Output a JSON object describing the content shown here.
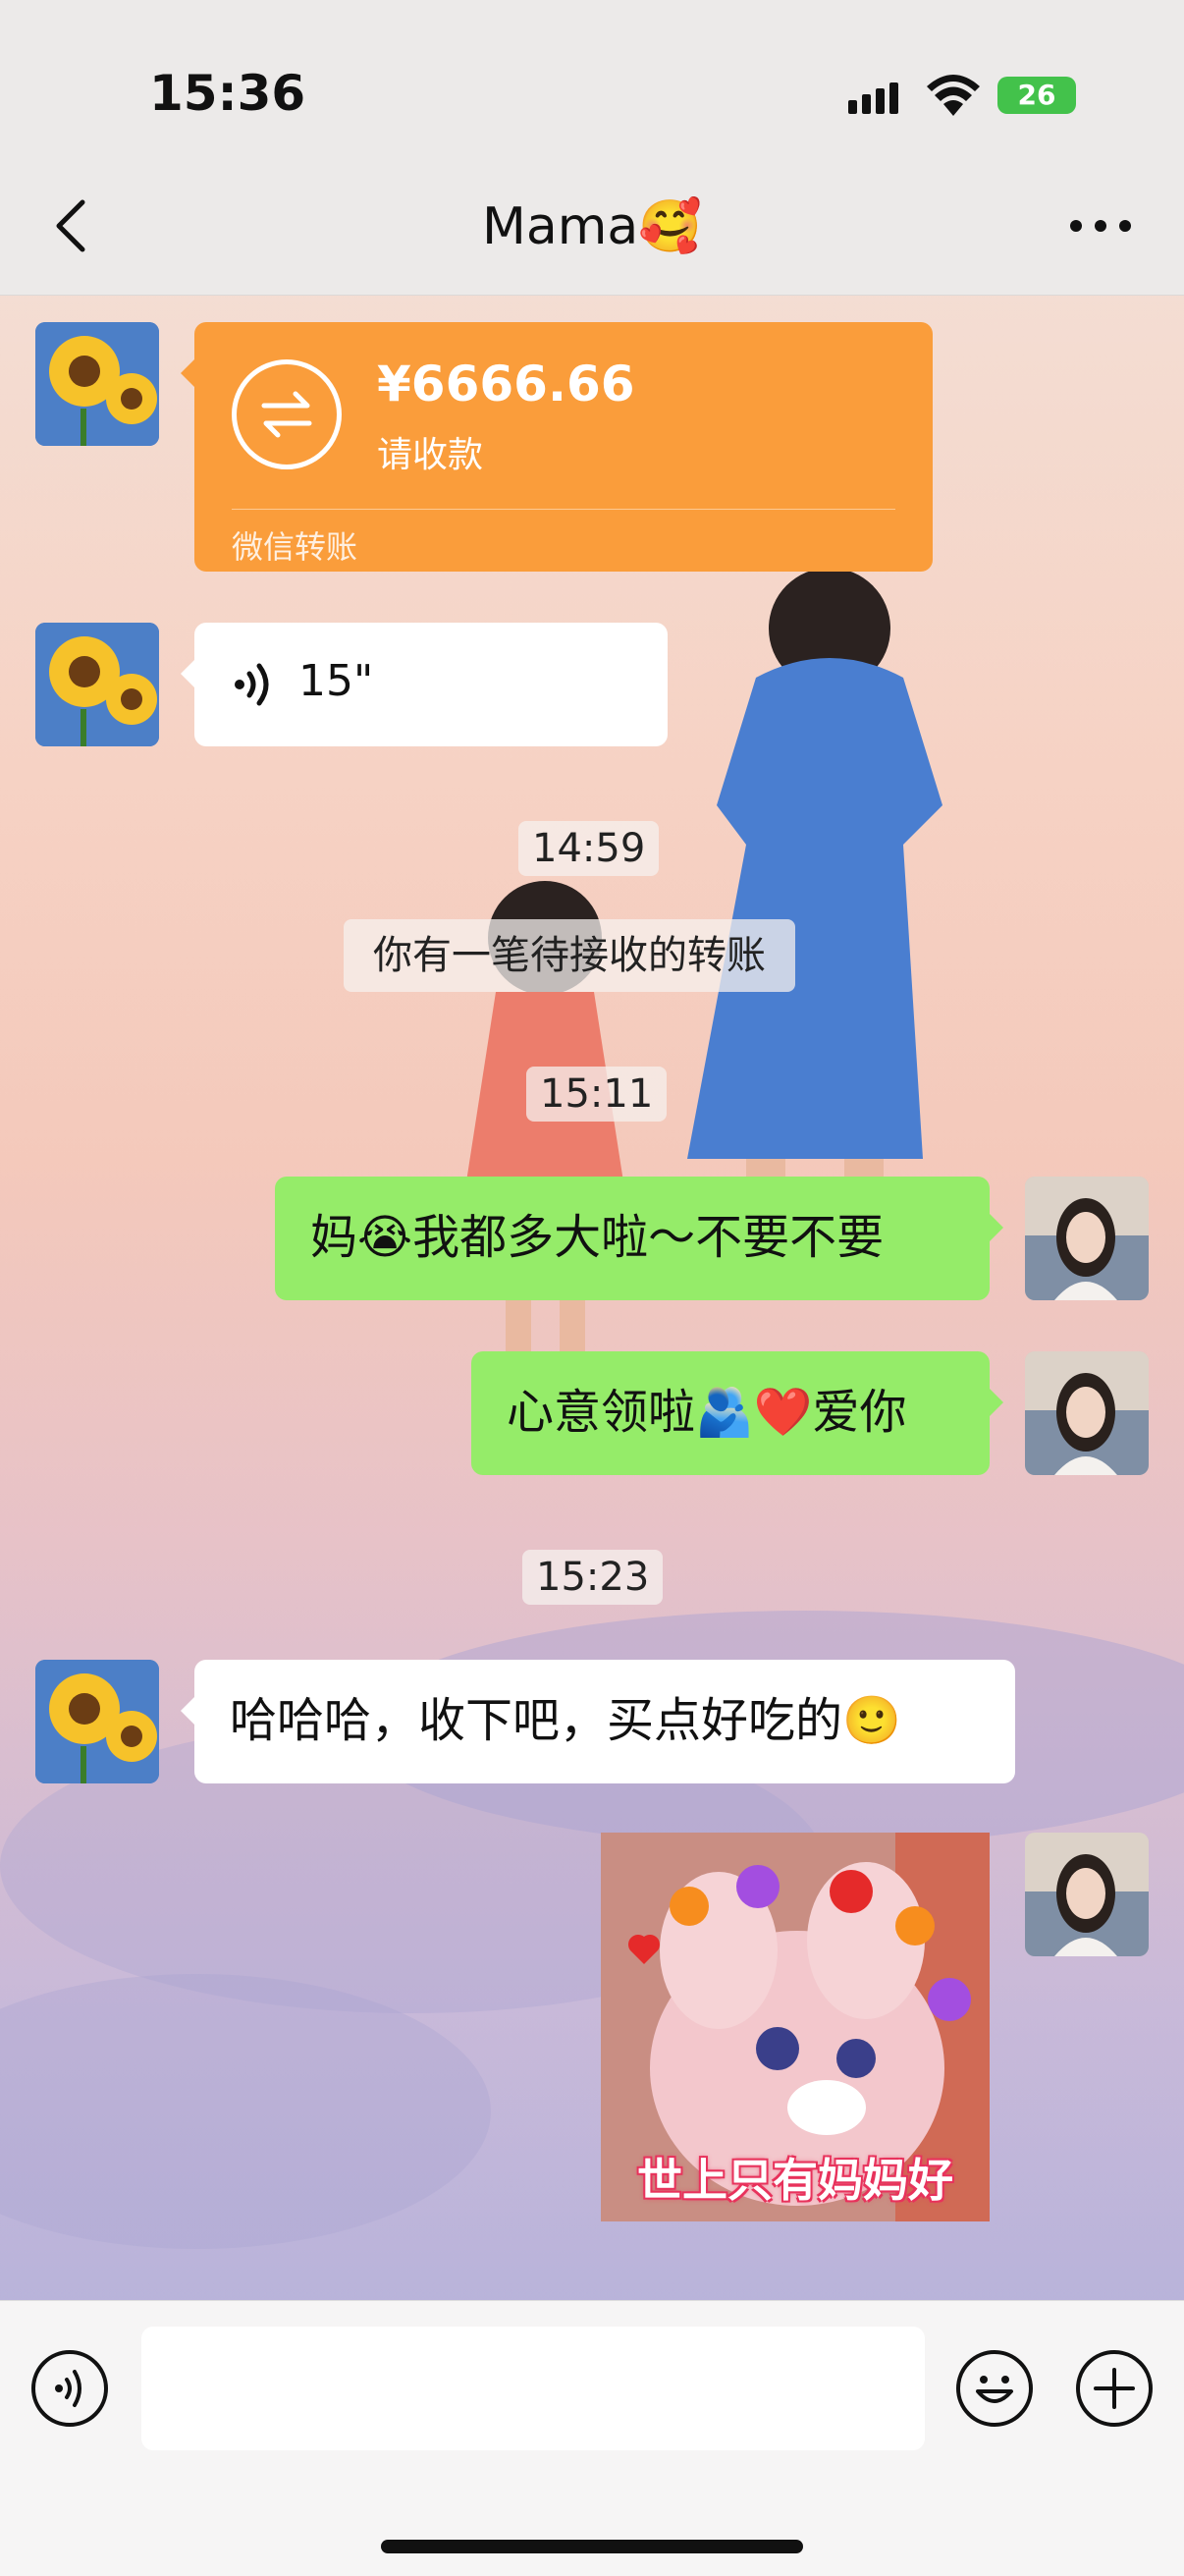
{
  "status_bar": {
    "time": "15:36",
    "battery": "26"
  },
  "nav": {
    "title": "Mama🥰"
  },
  "messages": {
    "transfer": {
      "amount": "¥6666.66",
      "status": "请收款",
      "footer": "微信转账"
    },
    "voice": {
      "duration": "15\""
    },
    "time1": "14:59",
    "notice": "你有一笔待接收的转账",
    "time2": "15:11",
    "reply1": "妈😭我都多大啦～不要不要",
    "reply2": "心意领啦🫂❤️爱你",
    "time3": "15:23",
    "mom_reply": "哈哈哈，收下吧，买点好吃的🙂",
    "sticker": {
      "caption": "世上只有妈妈好"
    }
  },
  "colors": {
    "transfer": "#fa9d3b",
    "my_bubble": "#95ec69",
    "their_bubble": "#ffffff"
  },
  "icons": {
    "back": "chevron-left-icon",
    "more": "more-icon",
    "voice": "voice-icon",
    "emoji": "emoji-icon",
    "add": "plus-icon",
    "transfer": "transfer-arrows-icon"
  }
}
